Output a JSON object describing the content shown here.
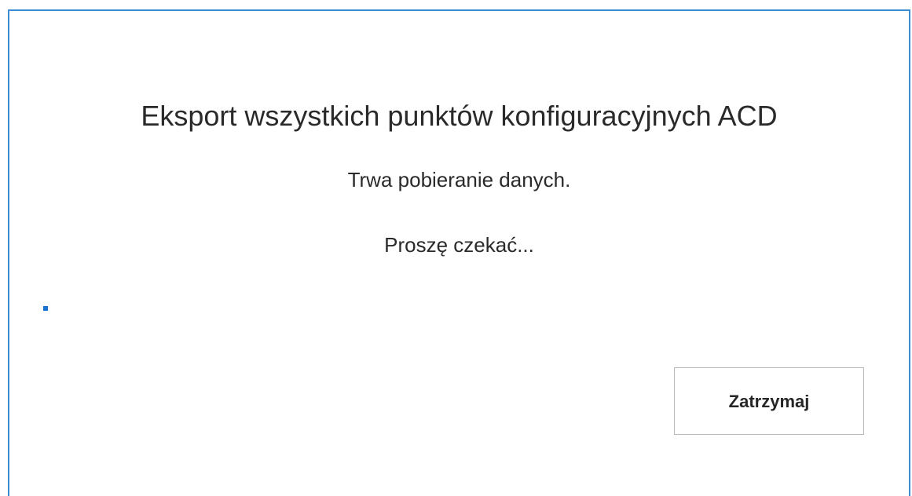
{
  "dialog": {
    "title": "Eksport wszystkich punktów konfiguracyjnych ACD",
    "status_line_1": "Trwa pobieranie danych.",
    "status_line_2": "Proszę czekać...",
    "stop_button_label": "Zatrzymaj"
  },
  "colors": {
    "border": "#3c8cd4",
    "progress": "#1a73d0",
    "text": "#2a2a2a"
  }
}
